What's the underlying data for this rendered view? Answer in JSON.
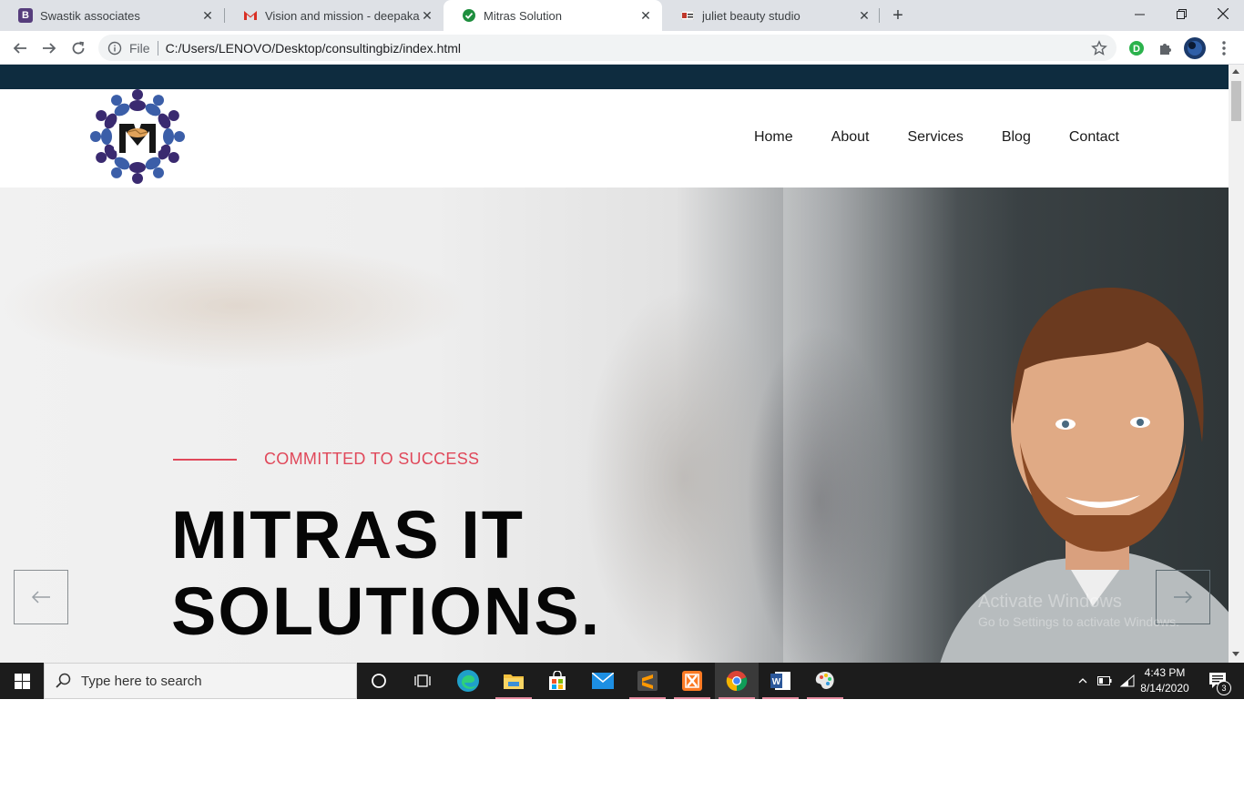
{
  "browser": {
    "tabs": [
      {
        "title": "Swastik associates",
        "favicon": "bootstrap-icon"
      },
      {
        "title": "Vision and mission - deepakalbur",
        "favicon": "gmail-icon"
      },
      {
        "title": "Mitras Solution",
        "favicon": "check-circle-icon",
        "active": true
      },
      {
        "title": "juliet beauty studio",
        "favicon": "flag-icon"
      }
    ],
    "new_tab_label": "+",
    "address": {
      "scheme": "File",
      "url": "C:/Users/LENOVO/Desktop/consultingbiz/index.html"
    }
  },
  "site": {
    "nav": [
      "Home",
      "About",
      "Services",
      "Blog",
      "Contact"
    ],
    "hero": {
      "tagline": "COMMITTED TO SUCCESS",
      "title_line1": "MITRAS IT",
      "title_line2": "SOLUTIONS."
    },
    "colors": {
      "topbar": "#0e2c3f",
      "accent": "#e0485a",
      "logo_blue": "#3b5ea8",
      "logo_purple": "#3a2a70"
    }
  },
  "watermark": {
    "line1": "Activate Windows",
    "line2": "Go to Settings to activate Windows."
  },
  "taskbar": {
    "search_placeholder": "Type here to search",
    "time": "4:43 PM",
    "date": "8/14/2020",
    "notification_count": "3"
  }
}
